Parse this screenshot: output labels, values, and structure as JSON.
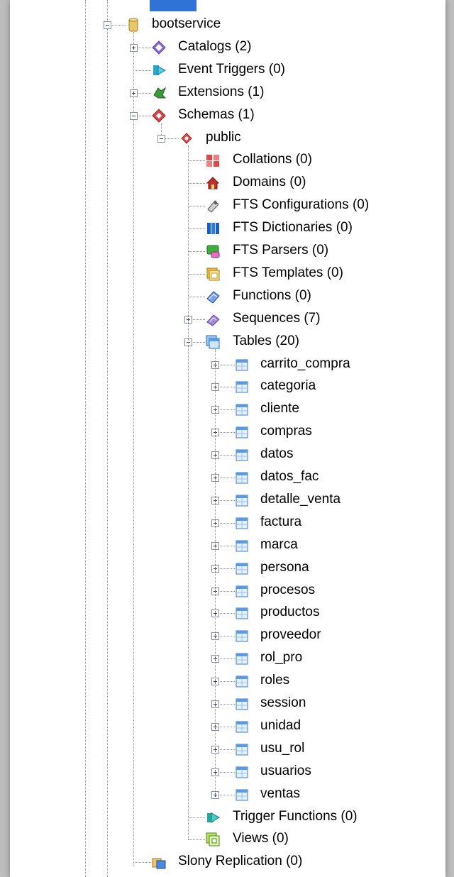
{
  "tree": {
    "database": {
      "label": "bootservice",
      "icon": "database-icon"
    },
    "db_children": [
      {
        "label": "Catalogs (2)",
        "icon": "catalogs-icon",
        "expander": "plus"
      },
      {
        "label": "Event Triggers (0)",
        "icon": "event-triggers-icon",
        "expander": "none"
      },
      {
        "label": "Extensions (1)",
        "icon": "extensions-icon",
        "expander": "plus"
      },
      {
        "label": "Schemas (1)",
        "icon": "schemas-icon",
        "expander": "minus"
      }
    ],
    "schema": {
      "label": "public",
      "icon": "schema-icon"
    },
    "schema_children": [
      {
        "label": "Collations (0)",
        "icon": "collations-icon",
        "expander": "none"
      },
      {
        "label": "Domains (0)",
        "icon": "domains-icon",
        "expander": "none"
      },
      {
        "label": "FTS Configurations (0)",
        "icon": "fts-configurations-icon",
        "expander": "none"
      },
      {
        "label": "FTS Dictionaries (0)",
        "icon": "fts-dictionaries-icon",
        "expander": "none"
      },
      {
        "label": "FTS Parsers (0)",
        "icon": "fts-parsers-icon",
        "expander": "none"
      },
      {
        "label": "FTS Templates (0)",
        "icon": "fts-templates-icon",
        "expander": "none"
      },
      {
        "label": "Functions (0)",
        "icon": "functions-icon",
        "expander": "none"
      },
      {
        "label": "Sequences (7)",
        "icon": "sequences-icon",
        "expander": "plus"
      },
      {
        "label": "Tables (20)",
        "icon": "tables-icon",
        "expander": "minus"
      }
    ],
    "tables": [
      "carrito_compra",
      "categoria",
      "cliente",
      "compras",
      "datos",
      "datos_fac",
      "detalle_venta",
      "factura",
      "marca",
      "persona",
      "procesos",
      "productos",
      "proveedor",
      "rol_pro",
      "roles",
      "session",
      "unidad",
      "usu_rol",
      "usuarios",
      "ventas"
    ],
    "table_icon": "table-icon",
    "after_tables": [
      {
        "label": "Trigger Functions (0)",
        "icon": "trigger-functions-icon",
        "expander": "none"
      },
      {
        "label": "Views (0)",
        "icon": "views-icon",
        "expander": "none"
      }
    ],
    "tail": {
      "label": "Slony Replication (0)",
      "icon": "slony-replication-icon",
      "expander": "none"
    }
  }
}
